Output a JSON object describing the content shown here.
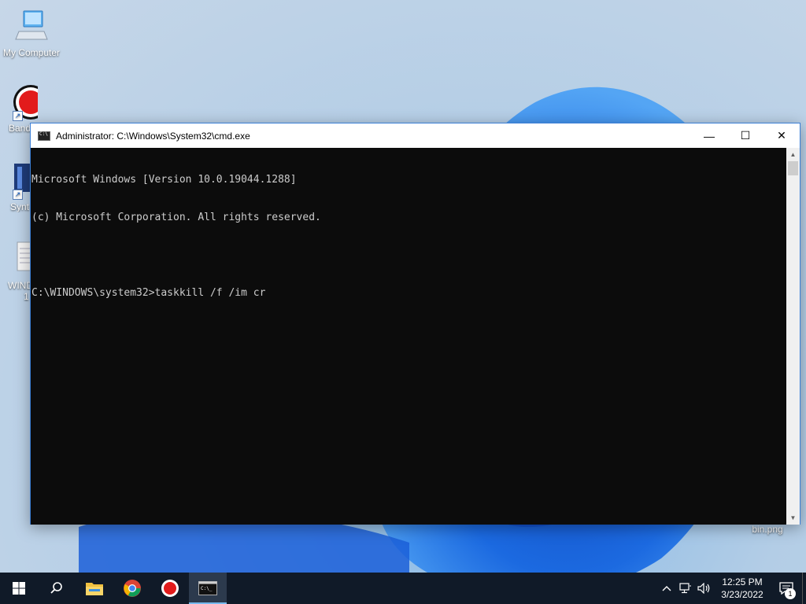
{
  "desktop": {
    "icons": [
      {
        "label": "My Computer"
      },
      {
        "label": "Band"
      },
      {
        "label": "Synt"
      },
      {
        "label": "WIND"
      },
      {
        "label": "1"
      },
      {
        "label": "bin.png"
      }
    ]
  },
  "window": {
    "title": "Administrator: C:\\Windows\\System32\\cmd.exe",
    "minimize_glyph": "—",
    "maximize_glyph": "☐",
    "close_glyph": "✕"
  },
  "console": {
    "lines": [
      "Microsoft Windows [Version 10.0.19044.1288]",
      "(c) Microsoft Corporation. All rights reserved.",
      "",
      "C:\\WINDOWS\\system32>taskkill /f /im cr"
    ]
  },
  "taskbar": {
    "time": "12:25 PM",
    "date": "3/23/2022",
    "notification_count": "1"
  },
  "colors": {
    "console_bg": "#0c0c0c",
    "console_fg": "#cccccc",
    "taskbar_bg": "#101a28",
    "accent": "#76b9ed"
  }
}
